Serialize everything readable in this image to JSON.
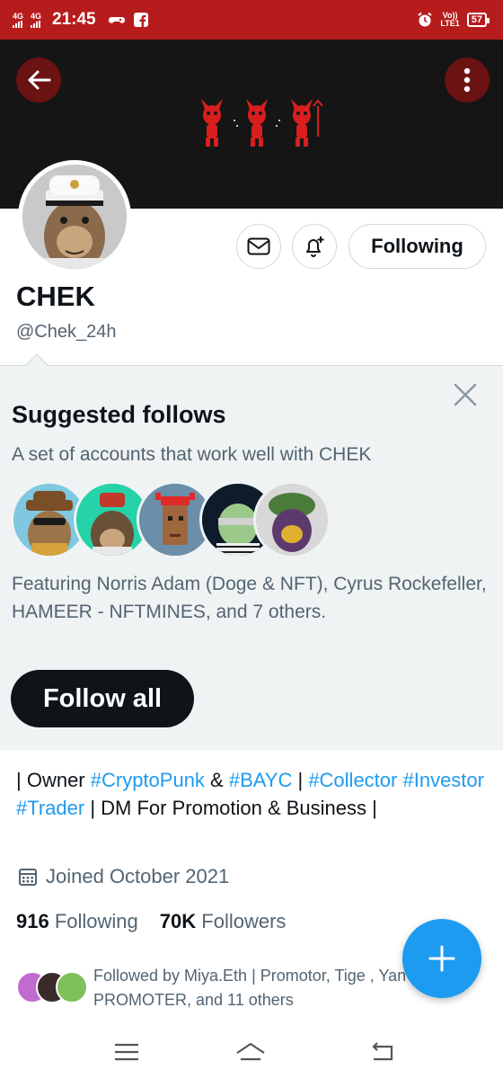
{
  "status_bar": {
    "network1": "4G",
    "network2": "4G",
    "time": "21:45",
    "volte_top": "Vo))",
    "volte_bottom": "LTE1",
    "battery": "57"
  },
  "profile": {
    "display_name": "CHEK",
    "handle": "@Chek_24h",
    "following_button": "Following"
  },
  "suggested": {
    "title": "Suggested follows",
    "subtitle": "A set of accounts that work well with CHEK",
    "featuring": "Featuring Norris Adam (Doge & NFT), Cyrus Rockefeller, HAMEER - NFTMINES, and 7 others.",
    "follow_all": "Follow all"
  },
  "bio": {
    "parts": [
      {
        "text": "| Owner ",
        "tag": false
      },
      {
        "text": "#CryptoPunk",
        "tag": true
      },
      {
        "text": " & ",
        "tag": false
      },
      {
        "text": "#BAYC",
        "tag": true
      },
      {
        "text": " | ",
        "tag": false
      },
      {
        "text": "#Collector",
        "tag": true
      },
      {
        "text": " ",
        "tag": false
      },
      {
        "text": "#Investor",
        "tag": true
      },
      {
        "text": " ",
        "tag": false
      },
      {
        "text": "#Trader",
        "tag": true
      },
      {
        "text": " | DM For Promotion & Business |",
        "tag": false
      }
    ]
  },
  "joined": "Joined October 2021",
  "stats": {
    "following_count": "916",
    "following_label": "Following",
    "followers_count": "70K",
    "followers_label": "Followers"
  },
  "followed_by": "Followed by Miya.Eth | Promotor, Tige  , Yan | NFT PROMOTER, and 11 others",
  "colors": {
    "status_bar": "#b71c1c",
    "banner": "#151515",
    "accent": "#1d9bf0",
    "panel": "#eff3f4"
  }
}
